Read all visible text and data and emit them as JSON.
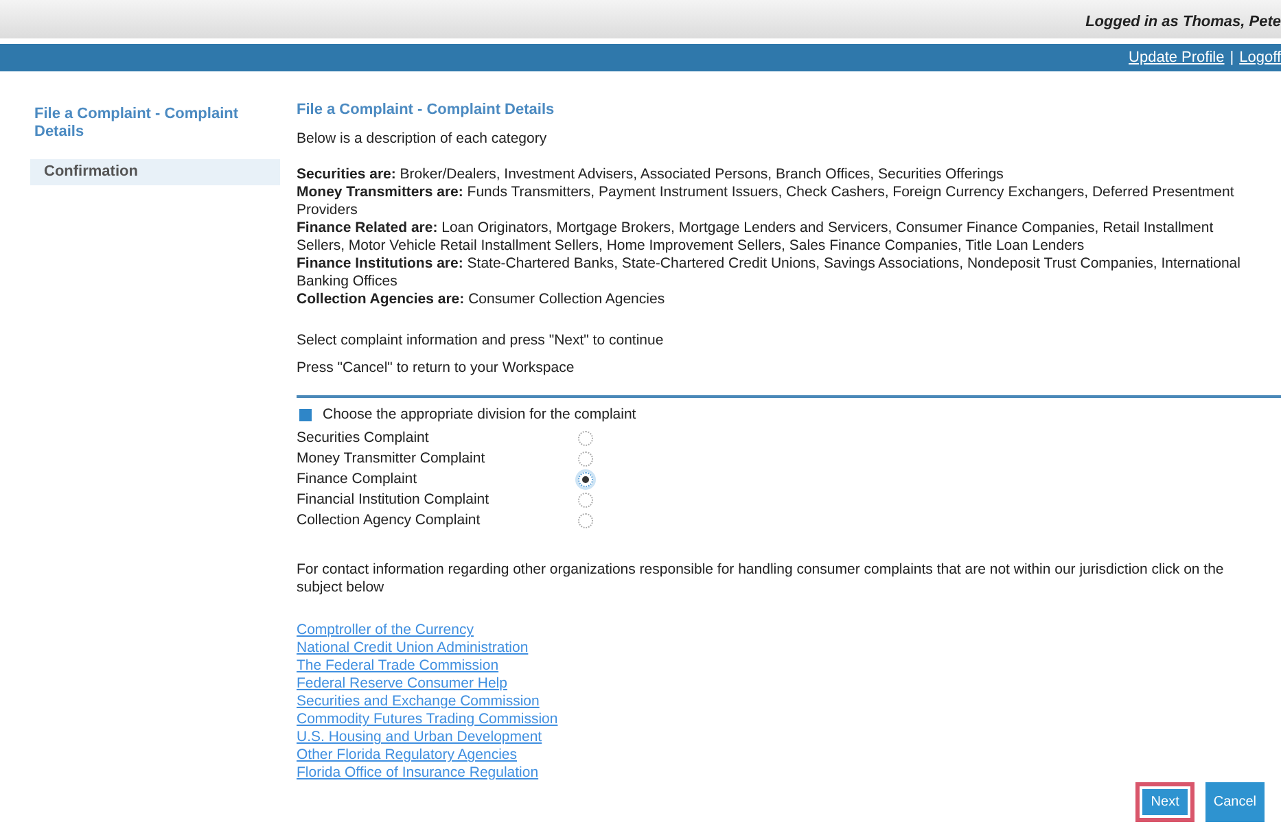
{
  "header": {
    "logged_in": "Logged in as Thomas, Pete",
    "links": [
      "Update Profile",
      "Logoff"
    ],
    "separator": "|"
  },
  "sidebar": {
    "items": [
      {
        "label": "File a Complaint - Complaint Details",
        "selected": false
      },
      {
        "label": "Confirmation",
        "selected": true
      }
    ]
  },
  "page_title": "File a Complaint - Complaint Details",
  "intro": "Below is a description of each category",
  "categories": [
    "**Securities are:** Broker/Dealers, Investment Advisers, Associated Persons, Branch Offices, Securities Offerings",
    "**Money Transmitters are:** Funds Transmitters, Payment Instrument Issuers, Check Cashers, Foreign Currency Exchangers, Deferred Presentment Providers",
    "**Finance Related are:** Loan Originators, Mortgage Brokers, Mortgage Lenders and Servicers, Consumer Finance Companies, Retail Installment Sellers, Motor Vehicle Retail Installment Sellers, Home Improvement Sellers, Sales Finance Companies, Title Loan Lenders",
    "**Finance Institutions are:** State-Chartered Banks, State-Chartered Credit Unions, Savings Associations, Nondeposit Trust Companies, International Banking Offices",
    "**Collection Agencies are:** Consumer Collection Agencies"
  ],
  "instructions": [
    "Select complaint information and press \"Next\" to continue",
    "Press \"Cancel\" to return to your Workspace"
  ],
  "division": {
    "label": "Choose the appropriate division for the complaint",
    "options": [
      {
        "label": "Securities Complaint",
        "selected": false
      },
      {
        "label": "Money Transmitter Complaint",
        "selected": false
      },
      {
        "label": "Finance Complaint",
        "selected": true
      },
      {
        "label": "Financial Institution Complaint",
        "selected": false
      },
      {
        "label": "Collection Agency Complaint",
        "selected": false
      }
    ]
  },
  "contact_text": "For contact information regarding other organizations responsible for handling consumer complaints that are not within our jurisdiction click on the subject below",
  "links": [
    "Comptroller of the Currency",
    "National Credit Union Administration",
    "The Federal Trade Commission",
    "Federal Reserve Consumer Help",
    "Securities and Exchange Commission",
    "Commodity Futures Trading Commission",
    "U.S. Housing and Urban Development",
    "Other Florida Regulatory Agencies",
    "Florida Office of Insurance Regulation"
  ],
  "buttons": [
    {
      "label": "Next",
      "highlighted": true
    },
    {
      "label": "Cancel",
      "highlighted": false
    }
  ]
}
